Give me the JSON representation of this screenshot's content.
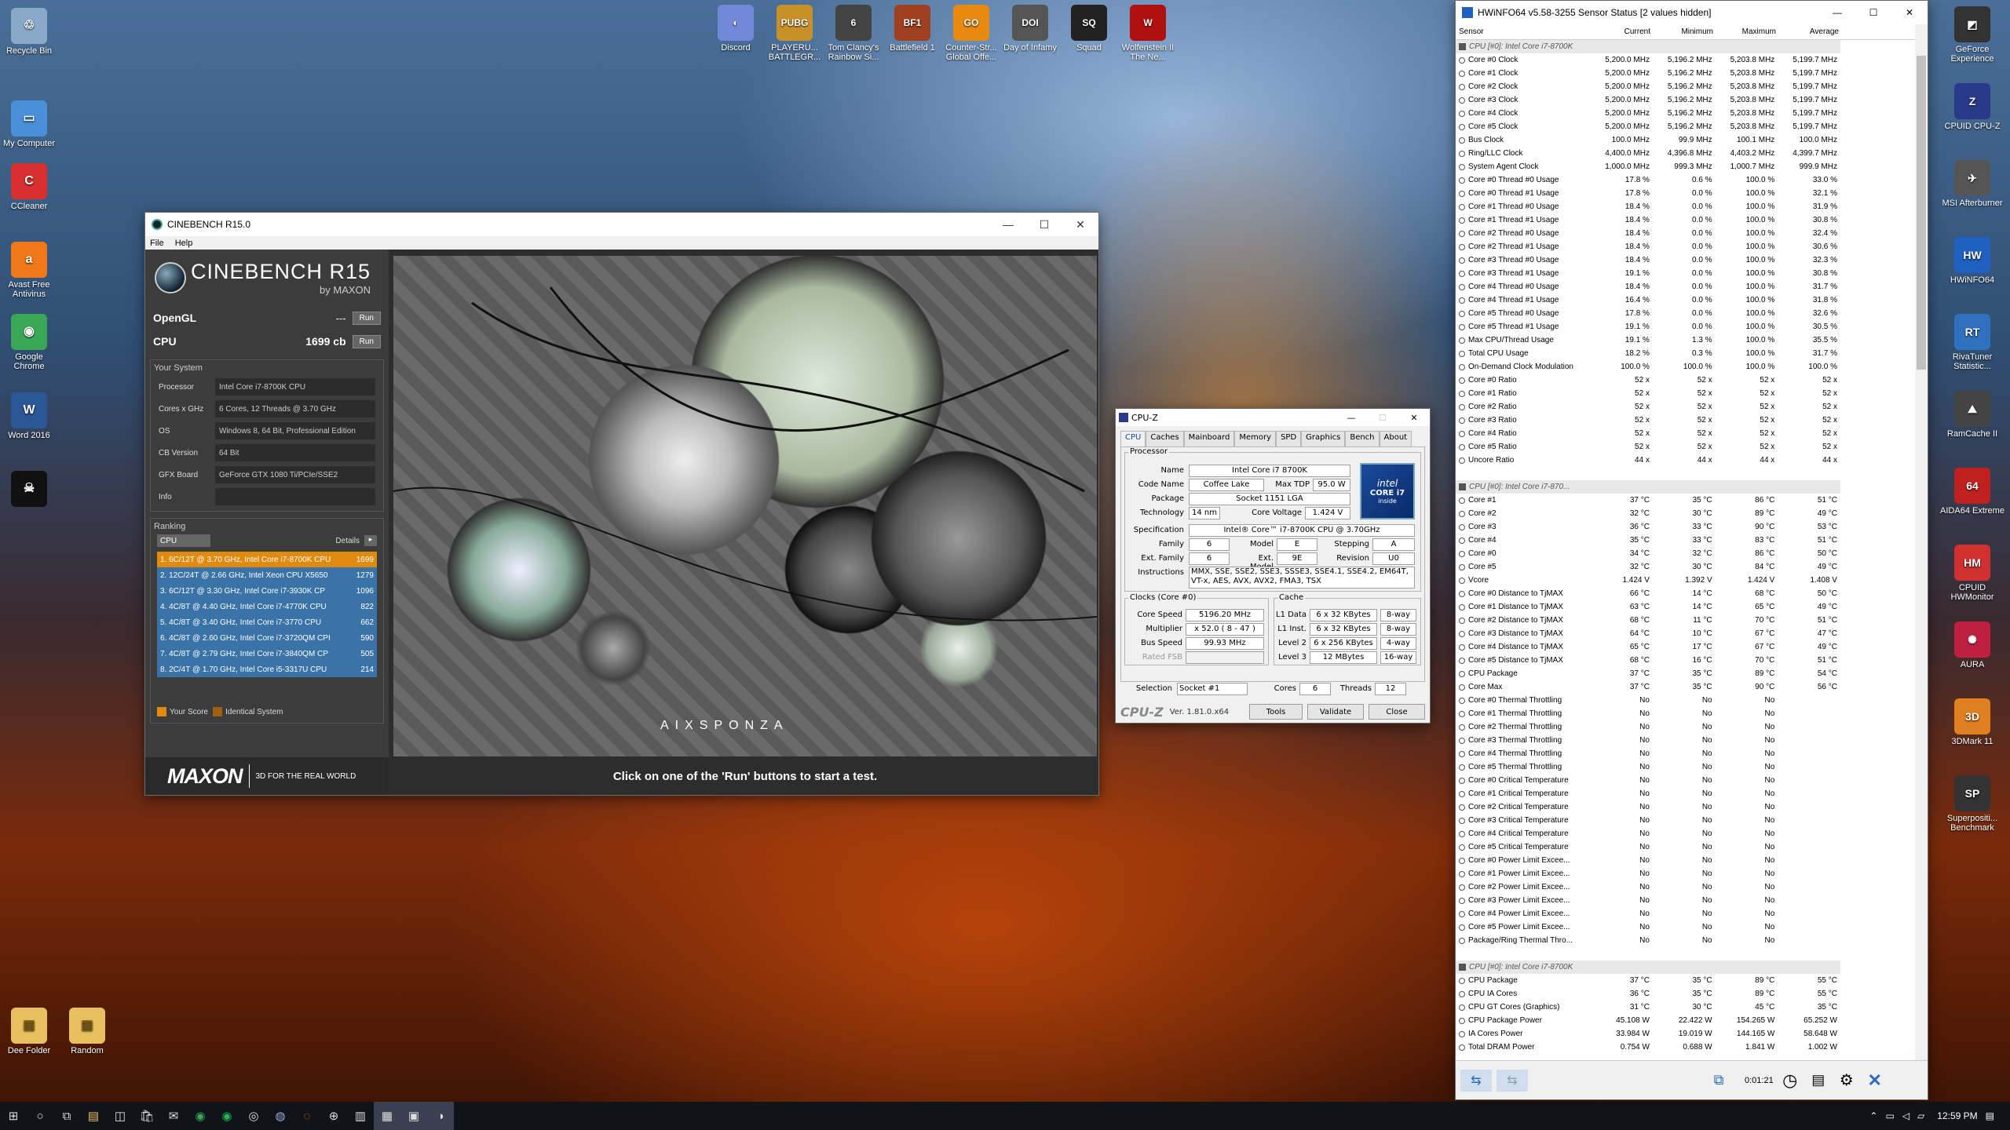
{
  "desktop_left": [
    {
      "label": "Recycle Bin",
      "name": "recycle-bin-icon",
      "color": "#8aa8c8",
      "glyph": "♲"
    },
    {
      "label": "My Computer",
      "name": "computer-icon",
      "color": "#4a8fd8",
      "glyph": "▭"
    },
    {
      "label": "CCleaner",
      "name": "ccleaner-icon",
      "color": "#d83030",
      "glyph": "C"
    },
    {
      "label": "Avast Free Antivirus",
      "name": "avast-icon",
      "color": "#f07818",
      "glyph": "a"
    },
    {
      "label": "Google Chrome",
      "name": "chrome-icon",
      "color": "#3aa757",
      "glyph": "◉"
    },
    {
      "label": "Word 2016",
      "name": "word-icon",
      "color": "#2b5797",
      "glyph": "W"
    },
    {
      "label": "",
      "name": "skull-app-icon",
      "color": "#111",
      "glyph": "☠"
    }
  ],
  "desktop_bottom": [
    {
      "label": "Dee Folder",
      "name": "folder-icon",
      "color": "#e8c060",
      "glyph": "▤"
    },
    {
      "label": "Random",
      "name": "folder-random-icon",
      "color": "#e8c060",
      "glyph": "▤"
    }
  ],
  "desktop_top": [
    {
      "label": "Discord",
      "name": "discord-icon",
      "color": "#7289da",
      "glyph": "◐"
    },
    {
      "label": "PLAYERU... BATTLEGR...",
      "name": "pubg-icon",
      "color": "#c89028",
      "glyph": "PUBG"
    },
    {
      "label": "Tom Clancy's Rainbow Si...",
      "name": "rainbow-six-icon",
      "color": "#444",
      "glyph": "6"
    },
    {
      "label": "Battlefield 1",
      "name": "battlefield-icon",
      "color": "#a04020",
      "glyph": "BF1"
    },
    {
      "label": "Counter-Str... Global Offe...",
      "name": "csgo-icon",
      "color": "#e88a10",
      "glyph": "GO"
    },
    {
      "label": "Day of Infamy",
      "name": "day-of-infamy-icon",
      "color": "#555",
      "glyph": "DOI"
    },
    {
      "label": "Squad",
      "name": "squad-icon",
      "color": "#222",
      "glyph": "SQ"
    },
    {
      "label": "Wolfenstein II The Ne...",
      "name": "wolfenstein-icon",
      "color": "#b01010",
      "glyph": "W"
    }
  ],
  "desktop_right": [
    {
      "label": "GeForce Experience",
      "name": "geforce-icon",
      "color": "#333",
      "glyph": "◩"
    },
    {
      "label": "CPUID CPU-Z",
      "name": "cpuz-icon",
      "color": "#2a3a8a",
      "glyph": "Z"
    },
    {
      "label": "MSI Afterburner",
      "name": "afterburner-icon",
      "color": "#555",
      "glyph": "✈"
    },
    {
      "label": "HWiNFO64",
      "name": "hwinfo-icon",
      "color": "#2060c0",
      "glyph": "HW"
    },
    {
      "label": "RivaTuner Statistic...",
      "name": "rivatuner-icon",
      "color": "#3070c0",
      "glyph": "RT"
    },
    {
      "label": "RamCache II",
      "name": "ramcache-icon",
      "color": "#444",
      "glyph": "⛰"
    },
    {
      "label": "AIDA64 Extreme",
      "name": "aida64-icon",
      "color": "#c02020",
      "glyph": "64"
    },
    {
      "label": "CPUID HWMonitor",
      "name": "hwmonitor-icon",
      "color": "#d03030",
      "glyph": "HM"
    },
    {
      "label": "AURA",
      "name": "aura-icon",
      "color": "#c02040",
      "glyph": "✺"
    },
    {
      "label": "3DMark 11",
      "name": "3dmark-icon",
      "color": "#e08020",
      "glyph": "3D"
    },
    {
      "label": "Superpositi... Benchmark",
      "name": "superposition-icon",
      "color": "#333",
      "glyph": "SP"
    }
  ],
  "cinebench": {
    "title": "CINEBENCH R15.0",
    "menu": [
      "File",
      "Help"
    ],
    "logo": "CINEBENCH R15",
    "logo_by": "by MAXON",
    "opengl_label": "OpenGL",
    "opengl_value": "---",
    "cpu_label": "CPU",
    "cpu_value": "1699 cb",
    "run": "Run",
    "your_system": "Your System",
    "system": [
      {
        "k": "Processor",
        "v": "Intel Core i7-8700K CPU"
      },
      {
        "k": "Cores x GHz",
        "v": "6 Cores, 12 Threads @ 3.70 GHz"
      },
      {
        "k": "OS",
        "v": "Windows 8, 64 Bit, Professional Edition"
      },
      {
        "k": "CB Version",
        "v": "64 Bit"
      },
      {
        "k": "GFX Board",
        "v": "GeForce GTX 1080 Ti/PCIe/SSE2"
      },
      {
        "k": "Info",
        "v": ""
      }
    ],
    "ranking": "Ranking",
    "rank_select": "CPU",
    "details": "Details",
    "ranks": [
      {
        "t": "1. 6C/12T @ 3.70 GHz, Intel Core i7-8700K CPU",
        "v": "1699",
        "c": "#e08a10"
      },
      {
        "t": "2. 12C/24T @ 2.66 GHz, Intel Xeon CPU X5650",
        "v": "1279",
        "c": "#3a73a8"
      },
      {
        "t": "3. 6C/12T @ 3.30 GHz, Intel Core i7-3930K CP",
        "v": "1096",
        "c": "#3a73a8"
      },
      {
        "t": "4. 4C/8T @ 4.40 GHz, Intel Core i7-4770K CPU",
        "v": "822",
        "c": "#3a73a8"
      },
      {
        "t": "5. 4C/8T @ 3.40 GHz,  Intel Core i7-3770 CPU",
        "v": "662",
        "c": "#3a73a8"
      },
      {
        "t": "6. 4C/8T @ 2.60 GHz,  Intel Core i7-3720QM CPI",
        "v": "590",
        "c": "#3a73a8"
      },
      {
        "t": "7. 4C/8T @ 2.79 GHz,  Intel Core i7-3840QM CP",
        "v": "505",
        "c": "#3a73a8"
      },
      {
        "t": "8. 2C/4T @ 1.70 GHz,  Intel Core i5-3317U CPU",
        "v": "214",
        "c": "#3a73a8"
      }
    ],
    "your_score": "Your Score",
    "identical": "Identical System",
    "maxon": "MAXON",
    "tagline": "3D FOR THE REAL WORLD",
    "aixsponza": "AIXSPONZA",
    "status": "Click on one of the 'Run' buttons to start a test."
  },
  "cpuz": {
    "title": "CPU-Z",
    "tabs": [
      "CPU",
      "Caches",
      "Mainboard",
      "Memory",
      "SPD",
      "Graphics",
      "Bench",
      "About"
    ],
    "processor": "Processor",
    "name_l": "Name",
    "name": "Intel Core i7 8700K",
    "code_l": "Code Name",
    "code": "Coffee Lake",
    "tdp_l": "Max TDP",
    "tdp": "95.0 W",
    "pkg_l": "Package",
    "pkg": "Socket 1151 LGA",
    "tech_l": "Technology",
    "tech": "14 nm",
    "volt_l": "Core Voltage",
    "volt": "1.424 V",
    "spec_l": "Specification",
    "spec": "Intel® Core™ i7-8700K CPU @ 3.70GHz",
    "fam_l": "Family",
    "fam": "6",
    "model_l": "Model",
    "model": "E",
    "step_l": "Stepping",
    "step": "A",
    "efam_l": "Ext. Family",
    "efam": "6",
    "emodel_l": "Ext. Model",
    "emodel": "9E",
    "rev_l": "Revision",
    "rev": "U0",
    "inst_l": "Instructions",
    "inst": "MMX, SSE, SSE2, SSE3, SSSE3, SSE4.1, SSE4.2, EM64T, VT-x, AES, AVX, AVX2, FMA3, TSX",
    "clocks": "Clocks (Core #0)",
    "cache": "Cache",
    "cs_l": "Core Speed",
    "cs": "5196.20 MHz",
    "mult_l": "Multiplier",
    "mult": "x 52.0 ( 8 - 47 )",
    "bus_l": "Bus Speed",
    "bus": "99.93 MHz",
    "fsb_l": "Rated FSB",
    "fsb": "",
    "l1d_l": "L1 Data",
    "l1d": "6 x 32 KBytes",
    "l1d_w": "8-way",
    "l1i_l": "L1 Inst.",
    "l1i": "6 x 32 KBytes",
    "l1i_w": "8-way",
    "l2_l": "Level 2",
    "l2": "6 x 256 KBytes",
    "l2_w": "4-way",
    "l3_l": "Level 3",
    "l3": "12 MBytes",
    "l3_w": "16-way",
    "sel_l": "Selection",
    "sel": "Socket #1",
    "cores_l": "Cores",
    "cores": "6",
    "thr_l": "Threads",
    "thr": "12",
    "brand": "CPU-Z",
    "ver": "Ver. 1.81.0.x64",
    "tools": "Tools",
    "validate": "Validate",
    "close": "Close",
    "intel1": "intel",
    "intel2": "CORE i7",
    "intel3": "inside"
  },
  "hwinfo": {
    "title": "HWiNFO64 v5.58-3255 Sensor Status [2 values hidden]",
    "cols": [
      "Sensor",
      "Current",
      "Minimum",
      "Maximum",
      "Average"
    ],
    "rows": [
      [
        "g",
        "CPU [#0]: Intel Core i7-8700K"
      ],
      [
        "Core #0 Clock",
        "5,200.0 MHz",
        "5,196.2 MHz",
        "5,203.8 MHz",
        "5,199.7 MHz"
      ],
      [
        "Core #1 Clock",
        "5,200.0 MHz",
        "5,196.2 MHz",
        "5,203.8 MHz",
        "5,199.7 MHz"
      ],
      [
        "Core #2 Clock",
        "5,200.0 MHz",
        "5,196.2 MHz",
        "5,203.8 MHz",
        "5,199.7 MHz"
      ],
      [
        "Core #3 Clock",
        "5,200.0 MHz",
        "5,196.2 MHz",
        "5,203.8 MHz",
        "5,199.7 MHz"
      ],
      [
        "Core #4 Clock",
        "5,200.0 MHz",
        "5,196.2 MHz",
        "5,203.8 MHz",
        "5,199.7 MHz"
      ],
      [
        "Core #5 Clock",
        "5,200.0 MHz",
        "5,196.2 MHz",
        "5,203.8 MHz",
        "5,199.7 MHz"
      ],
      [
        "Bus Clock",
        "100.0 MHz",
        "99.9 MHz",
        "100.1 MHz",
        "100.0 MHz"
      ],
      [
        "Ring/LLC Clock",
        "4,400.0 MHz",
        "4,396.8 MHz",
        "4,403.2 MHz",
        "4,399.7 MHz"
      ],
      [
        "System Agent Clock",
        "1,000.0 MHz",
        "999.3 MHz",
        "1,000.7 MHz",
        "999.9 MHz"
      ],
      [
        "Core #0 Thread #0 Usage",
        "17.8 %",
        "0.6 %",
        "100.0 %",
        "33.0 %"
      ],
      [
        "Core #0 Thread #1 Usage",
        "17.8 %",
        "0.0 %",
        "100.0 %",
        "32.1 %"
      ],
      [
        "Core #1 Thread #0 Usage",
        "18.4 %",
        "0.0 %",
        "100.0 %",
        "31.9 %"
      ],
      [
        "Core #1 Thread #1 Usage",
        "18.4 %",
        "0.0 %",
        "100.0 %",
        "30.8 %"
      ],
      [
        "Core #2 Thread #0 Usage",
        "18.4 %",
        "0.0 %",
        "100.0 %",
        "32.4 %"
      ],
      [
        "Core #2 Thread #1 Usage",
        "18.4 %",
        "0.0 %",
        "100.0 %",
        "30.6 %"
      ],
      [
        "Core #3 Thread #0 Usage",
        "18.4 %",
        "0.0 %",
        "100.0 %",
        "32.3 %"
      ],
      [
        "Core #3 Thread #1 Usage",
        "19.1 %",
        "0.0 %",
        "100.0 %",
        "30.8 %"
      ],
      [
        "Core #4 Thread #0 Usage",
        "18.4 %",
        "0.0 %",
        "100.0 %",
        "31.7 %"
      ],
      [
        "Core #4 Thread #1 Usage",
        "16.4 %",
        "0.0 %",
        "100.0 %",
        "31.8 %"
      ],
      [
        "Core #5 Thread #0 Usage",
        "17.8 %",
        "0.0 %",
        "100.0 %",
        "32.6 %"
      ],
      [
        "Core #5 Thread #1 Usage",
        "19.1 %",
        "0.0 %",
        "100.0 %",
        "30.5 %"
      ],
      [
        "Max CPU/Thread Usage",
        "19.1 %",
        "1.3 %",
        "100.0 %",
        "35.5 %"
      ],
      [
        "Total CPU Usage",
        "18.2 %",
        "0.3 %",
        "100.0 %",
        "31.7 %"
      ],
      [
        "On-Demand Clock Modulation",
        "100.0 %",
        "100.0 %",
        "100.0 %",
        "100.0 %"
      ],
      [
        "Core #0 Ratio",
        "52 x",
        "52 x",
        "52 x",
        "52 x"
      ],
      [
        "Core #1 Ratio",
        "52 x",
        "52 x",
        "52 x",
        "52 x"
      ],
      [
        "Core #2 Ratio",
        "52 x",
        "52 x",
        "52 x",
        "52 x"
      ],
      [
        "Core #3 Ratio",
        "52 x",
        "52 x",
        "52 x",
        "52 x"
      ],
      [
        "Core #4 Ratio",
        "52 x",
        "52 x",
        "52 x",
        "52 x"
      ],
      [
        "Core #5 Ratio",
        "52 x",
        "52 x",
        "52 x",
        "52 x"
      ],
      [
        "Uncore Ratio",
        "44 x",
        "44 x",
        "44 x",
        "44 x"
      ],
      [
        "s",
        ""
      ],
      [
        "g",
        "CPU [#0]: Intel Core i7-870..."
      ],
      [
        "Core #1",
        "37 °C",
        "35 °C",
        "86 °C",
        "51 °C"
      ],
      [
        "Core #2",
        "32 °C",
        "30 °C",
        "89 °C",
        "49 °C"
      ],
      [
        "Core #3",
        "36 °C",
        "33 °C",
        "90 °C",
        "53 °C"
      ],
      [
        "Core #4",
        "35 °C",
        "33 °C",
        "83 °C",
        "51 °C"
      ],
      [
        "Core #0",
        "34 °C",
        "32 °C",
        "86 °C",
        "50 °C"
      ],
      [
        "Core #5",
        "32 °C",
        "30 °C",
        "84 °C",
        "49 °C"
      ],
      [
        "Vcore",
        "1.424 V",
        "1.392 V",
        "1.424 V",
        "1.408 V"
      ],
      [
        "Core #0 Distance to TjMAX",
        "66 °C",
        "14 °C",
        "68 °C",
        "50 °C"
      ],
      [
        "Core #1 Distance to TjMAX",
        "63 °C",
        "14 °C",
        "65 °C",
        "49 °C"
      ],
      [
        "Core #2 Distance to TjMAX",
        "68 °C",
        "11 °C",
        "70 °C",
        "51 °C"
      ],
      [
        "Core #3 Distance to TjMAX",
        "64 °C",
        "10 °C",
        "67 °C",
        "47 °C"
      ],
      [
        "Core #4 Distance to TjMAX",
        "65 °C",
        "17 °C",
        "67 °C",
        "49 °C"
      ],
      [
        "Core #5 Distance to TjMAX",
        "68 °C",
        "16 °C",
        "70 °C",
        "51 °C"
      ],
      [
        "CPU Package",
        "37 °C",
        "35 °C",
        "89 °C",
        "54 °C"
      ],
      [
        "Core Max",
        "37 °C",
        "35 °C",
        "90 °C",
        "56 °C"
      ],
      [
        "Core #0 Thermal Throttling",
        "No",
        "No",
        "No",
        ""
      ],
      [
        "Core #1 Thermal Throttling",
        "No",
        "No",
        "No",
        ""
      ],
      [
        "Core #2 Thermal Throttling",
        "No",
        "No",
        "No",
        ""
      ],
      [
        "Core #3 Thermal Throttling",
        "No",
        "No",
        "No",
        ""
      ],
      [
        "Core #4 Thermal Throttling",
        "No",
        "No",
        "No",
        ""
      ],
      [
        "Core #5 Thermal Throttling",
        "No",
        "No",
        "No",
        ""
      ],
      [
        "Core #0 Critical Temperature",
        "No",
        "No",
        "No",
        ""
      ],
      [
        "Core #1 Critical Temperature",
        "No",
        "No",
        "No",
        ""
      ],
      [
        "Core #2 Critical Temperature",
        "No",
        "No",
        "No",
        ""
      ],
      [
        "Core #3 Critical Temperature",
        "No",
        "No",
        "No",
        ""
      ],
      [
        "Core #4 Critical Temperature",
        "No",
        "No",
        "No",
        ""
      ],
      [
        "Core #5 Critical Temperature",
        "No",
        "No",
        "No",
        ""
      ],
      [
        "Core #0 Power Limit Excee...",
        "No",
        "No",
        "No",
        ""
      ],
      [
        "Core #1 Power Limit Excee...",
        "No",
        "No",
        "No",
        ""
      ],
      [
        "Core #2 Power Limit Excee...",
        "No",
        "No",
        "No",
        ""
      ],
      [
        "Core #3 Power Limit Excee...",
        "No",
        "No",
        "No",
        ""
      ],
      [
        "Core #4 Power Limit Excee...",
        "No",
        "No",
        "No",
        ""
      ],
      [
        "Core #5 Power Limit Excee...",
        "No",
        "No",
        "No",
        ""
      ],
      [
        "Package/Ring Thermal Thro...",
        "No",
        "No",
        "No",
        ""
      ],
      [
        "s",
        ""
      ],
      [
        "g",
        "CPU [#0]: Intel Core i7-8700K"
      ],
      [
        "CPU Package",
        "37 °C",
        "35 °C",
        "89 °C",
        "55 °C"
      ],
      [
        "CPU IA Cores",
        "36 °C",
        "35 °C",
        "89 °C",
        "55 °C"
      ],
      [
        "CPU GT Cores (Graphics)",
        "31 °C",
        "30 °C",
        "45 °C",
        "35 °C"
      ],
      [
        "CPU Package Power",
        "45.108 W",
        "22.422 W",
        "154.265 W",
        "65.252 W"
      ],
      [
        "IA Cores Power",
        "33.984 W",
        "19.019 W",
        "144.165 W",
        "58.648 W"
      ],
      [
        "Total DRAM Power",
        "0.754 W",
        "0.688 W",
        "1.841 W",
        "1.002 W"
      ]
    ],
    "time": "0:01:21"
  },
  "taskbar": {
    "time": "12:59 PM"
  }
}
